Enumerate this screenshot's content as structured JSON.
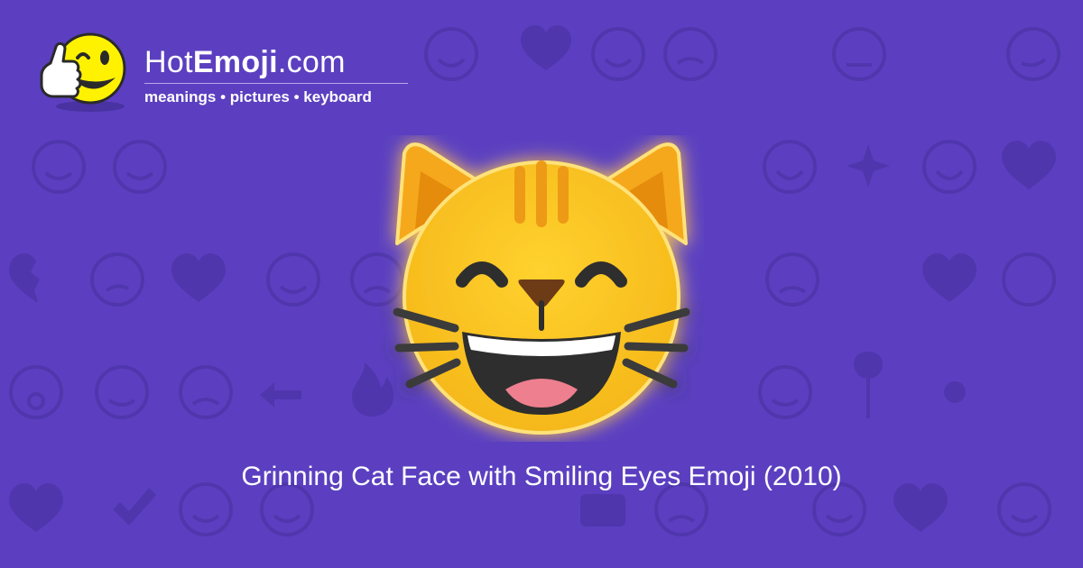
{
  "brand": {
    "name_prefix": "Hot",
    "name_bold": "Emoji",
    "name_suffix": ".com",
    "tagline": "meanings • pictures • keyboard"
  },
  "hero": {
    "emoji_icon": "grinning-cat-face-with-smiling-eyes-icon",
    "caption": "Grinning Cat Face with Smiling Eyes Emoji (2010)"
  },
  "background": {
    "pattern": "faded-emoji-grid",
    "icons": [
      "smiley-icon",
      "heart-icon",
      "winking-face-icon",
      "ok-hand-icon",
      "eyes-icon",
      "smirk-icon",
      "sparkles-icon",
      "broken-heart-icon",
      "fire-icon",
      "rose-icon",
      "sun-icon",
      "flexed-biceps-icon",
      "check-mark-icon",
      "camera-icon",
      "left-arrow-icon",
      "monkey-icon"
    ]
  },
  "colors": {
    "background": "#5b3fc0",
    "pattern": "#5438b4",
    "cat_yellow": "#fcc21b",
    "cat_orange": "#ed9a16",
    "text": "#ffffff"
  }
}
